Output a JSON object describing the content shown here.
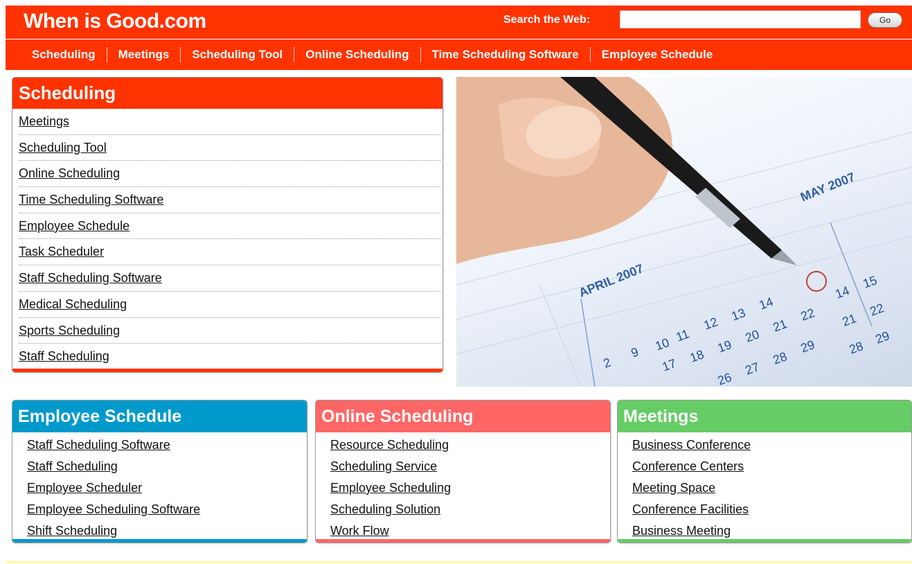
{
  "site": {
    "title": "When is Good.com"
  },
  "search": {
    "label": "Search the Web:",
    "value": "",
    "placeholder": "",
    "button_label": "Go"
  },
  "nav": {
    "items": [
      {
        "label": "Scheduling"
      },
      {
        "label": "Meetings"
      },
      {
        "label": "Scheduling Tool"
      },
      {
        "label": "Online Scheduling"
      },
      {
        "label": "Time Scheduling Software"
      },
      {
        "label": "Employee Schedule"
      }
    ]
  },
  "scheduling_box": {
    "title": "Scheduling",
    "links": [
      "Meetings",
      "Scheduling Tool",
      "Online Scheduling",
      "Time Scheduling Software",
      "Employee Schedule",
      "Task Scheduler",
      "Staff Scheduling Software",
      "Medical Scheduling",
      "Sports Scheduling",
      "Staff Scheduling"
    ]
  },
  "hero_image": {
    "calendar_labels": [
      "APRIL 2007",
      "MAY 2007"
    ]
  },
  "boxes": {
    "employee": {
      "title": "Employee Schedule",
      "links": [
        "Staff Scheduling Software",
        "Staff Scheduling",
        "Employee Scheduler",
        "Employee Scheduling Software",
        "Shift Scheduling"
      ]
    },
    "online": {
      "title": "Online Scheduling",
      "links": [
        "Resource Scheduling",
        "Scheduling Service",
        "Employee Scheduling",
        "Scheduling Solution",
        "Work Flow"
      ]
    },
    "meetings": {
      "title": "Meetings",
      "links": [
        "Business Conference",
        "Conference Centers",
        "Meeting Space",
        "Conference Facilities",
        "Business Meeting"
      ]
    }
  },
  "colors": {
    "brand_red": "#ff3300",
    "employee_blue": "#0099cc",
    "online_salmon": "#ff6666",
    "meetings_green": "#66cc66",
    "footer_yellow": "#ffff99"
  }
}
